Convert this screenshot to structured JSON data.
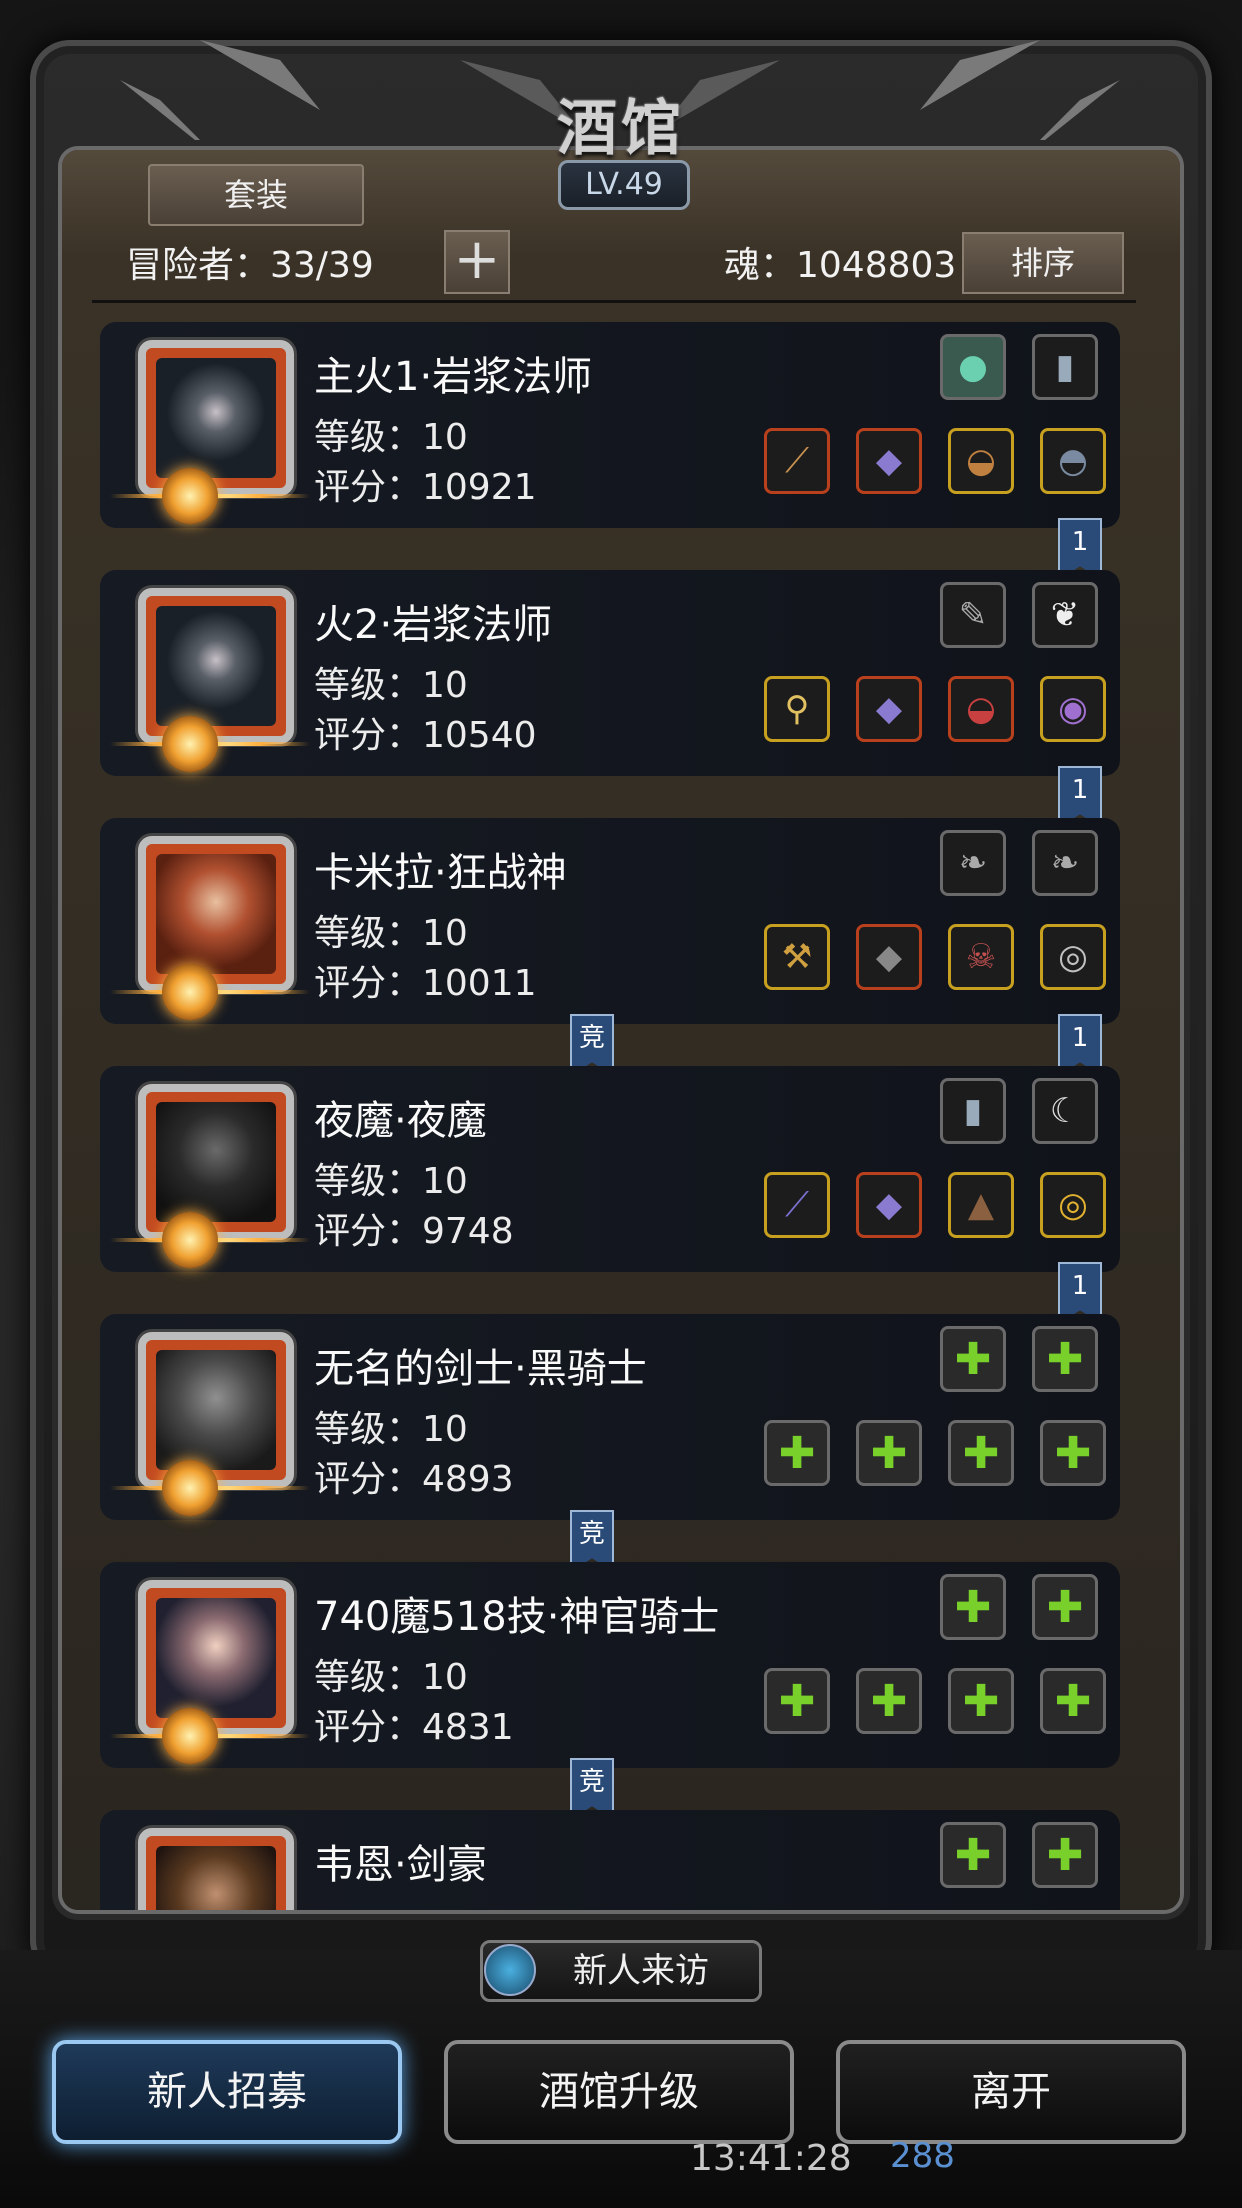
{
  "header": {
    "title": "酒馆",
    "level": "LV.49",
    "set_button": "套装",
    "adventurers": "冒险者：33/39",
    "plus": "+",
    "soul": "魂：1048803",
    "sort_button": "排序"
  },
  "heroes": [
    {
      "name": "主火1·岩浆法师",
      "level": "等级：10",
      "score": "评分：10921",
      "top_icons": [
        "stone",
        "book"
      ],
      "bottom_icons": [
        "staff",
        "armor",
        "helm",
        "mask"
      ]
    },
    {
      "name": "火2·岩浆法师",
      "level": "等级：10",
      "score": "评分：10540",
      "top_icons": [
        "dagger",
        "feather"
      ],
      "bottom_icons": [
        "scepter",
        "armor",
        "helm",
        "eye"
      ]
    },
    {
      "name": "卡米拉·狂战神",
      "level": "等级：10",
      "score": "评分：10011",
      "top_icons": [
        "feather",
        "feather"
      ],
      "bottom_icons": [
        "axe",
        "armor",
        "skull",
        "ring"
      ]
    },
    {
      "name": "夜魔·夜魔",
      "level": "等级：10",
      "score": "评分：9748",
      "top_icons": [
        "book",
        "horn"
      ],
      "bottom_icons": [
        "sword",
        "armor",
        "cloak",
        "ring"
      ]
    },
    {
      "name": "无名的剑士·黑骑士",
      "level": "等级：10",
      "score": "评分：4893",
      "top_icons": [
        "empty",
        "empty"
      ],
      "bottom_icons": [
        "empty",
        "empty",
        "empty",
        "empty"
      ]
    },
    {
      "name": "740魔518技·神官骑士",
      "level": "等级：10",
      "score": "评分：4831",
      "top_icons": [
        "empty",
        "empty"
      ],
      "bottom_icons": [
        "empty",
        "empty",
        "empty",
        "empty"
      ]
    },
    {
      "name": "韦恩·剑豪",
      "level": "",
      "score": "",
      "top_icons": [
        "empty",
        "empty"
      ],
      "bottom_icons": []
    }
  ],
  "bookmarks": {
    "right_label": "1",
    "mid_label": "竞"
  },
  "footer": {
    "visit": "新人来访",
    "recruit": "新人招募",
    "upgrade": "酒馆升级",
    "leave": "离开",
    "clock": "13:41:28",
    "blue_count": "288"
  },
  "colors": {
    "frame_red": "#b8401c",
    "frame_gold": "#c8a020",
    "empty_plus": "#7ad02a",
    "bookmark_blue": "#2a4a78"
  }
}
